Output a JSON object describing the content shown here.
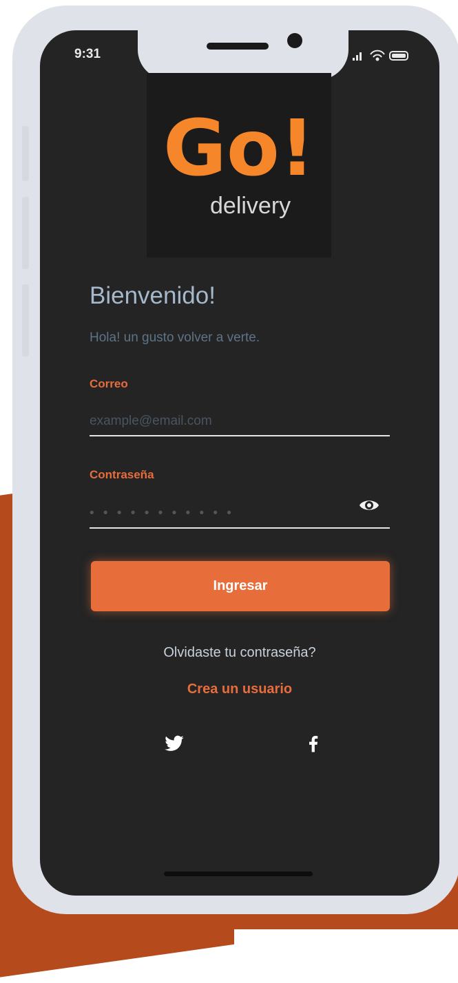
{
  "status_bar": {
    "time": "9:31"
  },
  "logo": {
    "brand_main": "Go!",
    "brand_sub": "delivery"
  },
  "welcome": {
    "title": "Bienvenido!",
    "subtitle": "Hola! un gusto volver a verte."
  },
  "form": {
    "email": {
      "label": "Correo",
      "placeholder": "example@email.com",
      "value": ""
    },
    "password": {
      "label": "Contraseña",
      "placeholder": "• • • • • • • • • • •",
      "value": ""
    },
    "submit_label": "Ingresar"
  },
  "links": {
    "forgot": "Olvidaste tu contraseña?",
    "create": "Crea un usuario"
  },
  "social": {
    "icons": [
      "twitter-icon",
      "facebook-icon"
    ]
  },
  "colors": {
    "accent": "#e76e3b",
    "brand_orange": "#f5872a",
    "screen_bg": "#242424",
    "title_text": "#a6b8cc",
    "backdrop_rust": "#b54a1c"
  }
}
